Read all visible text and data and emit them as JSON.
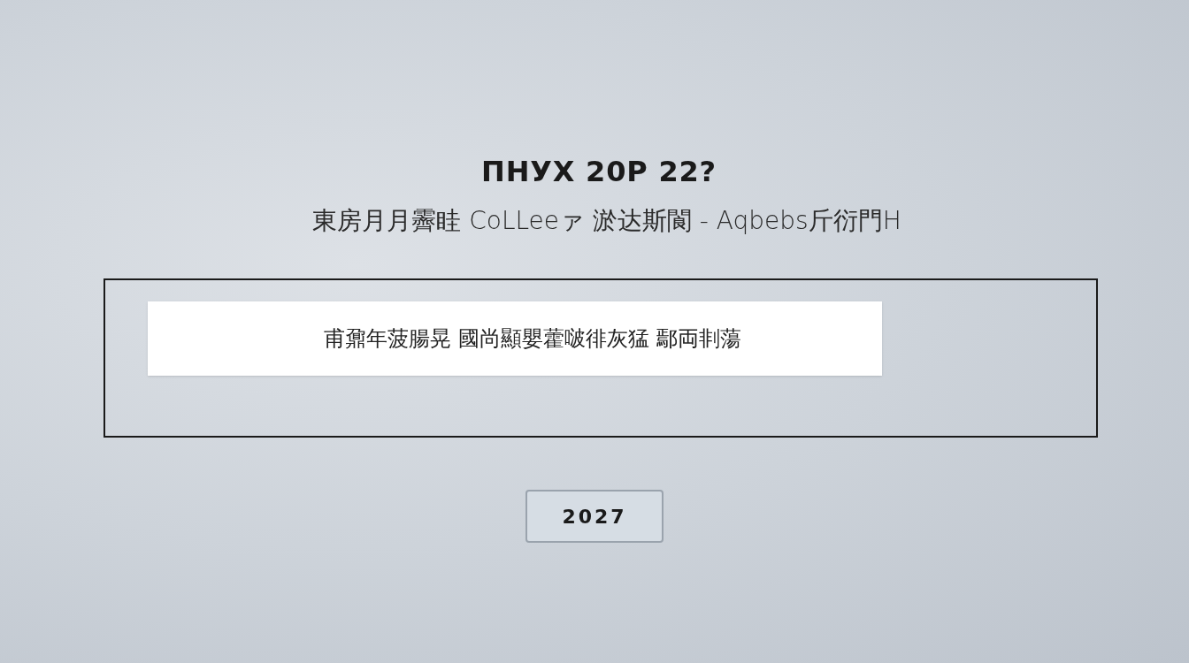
{
  "heading": "ПНУХ 20Р 22?",
  "subheading": "東房月月霽眭 CoLLeeァ 淤达斯閬 - Aqbebs斤衍門H",
  "panel": {
    "field": {
      "value": "甫鼐年菠腸晃 國尚顯嬰藿啵徘灰猛 鄢両剕蕩"
    }
  },
  "button": {
    "label": "2027"
  }
}
